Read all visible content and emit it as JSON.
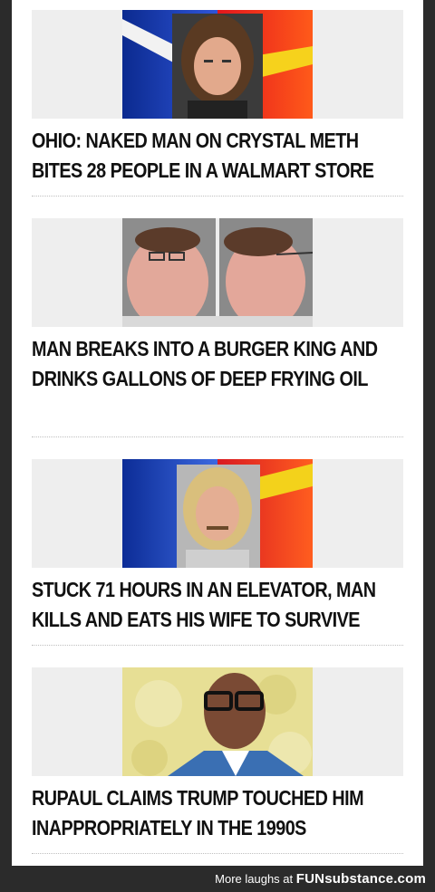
{
  "articles": [
    {
      "headline": "OHIO: NAKED MAN ON CRYSTAL METH BITES 28 PEOPLE IN A WALMART STORE",
      "image_alt": "mugshot-with-police-tape"
    },
    {
      "headline": "MAN BREAKS INTO A BURGER KING AND DRINKS GALLONS OF DEEP FRYING OIL",
      "image_alt": "front-and-side-mugshot"
    },
    {
      "headline": "STUCK 71 HOURS IN AN ELEVATOR, MAN KILLS AND EATS HIS WIFE TO SURVIVE",
      "image_alt": "mugshot-with-police-tape"
    },
    {
      "headline": "RUPAUL CLAIMS TRUMP TOUCHED HIM INAPPROPRIATELY IN THE 1990S",
      "image_alt": "portrait-with-glasses"
    }
  ],
  "footer": {
    "prefix": "More laughs at",
    "brand": "FUNsubstance.com"
  },
  "colors": {
    "background": "#2b2b2b",
    "card": "#ffffff",
    "text": "#111111",
    "divider": "#bfbfbf"
  }
}
